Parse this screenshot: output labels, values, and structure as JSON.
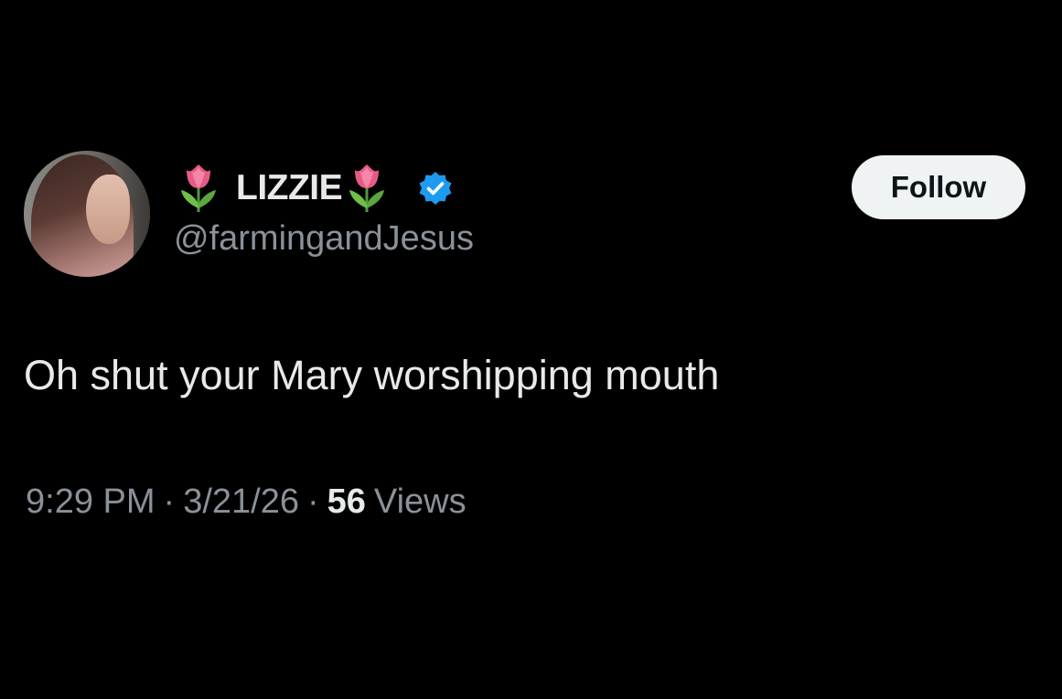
{
  "tweet": {
    "display_name": "LIZZIE",
    "handle": "@farmingandJesus",
    "follow_label": "Follow",
    "text": "Oh shut your Mary worshipping mouth",
    "time": "9:29 PM",
    "date": "3/21/26",
    "separator": "·",
    "views_count": "56",
    "views_label": "Views",
    "name_emoji": "tulip-icon",
    "verified_icon": "verified-badge-icon"
  },
  "colors": {
    "background": "#000000",
    "primary_text": "#e7e9ea",
    "secondary_text": "#8b9199",
    "verified_blue": "#1d9bf0",
    "follow_button_bg": "#eff3f4",
    "follow_button_text": "#0f1419"
  }
}
